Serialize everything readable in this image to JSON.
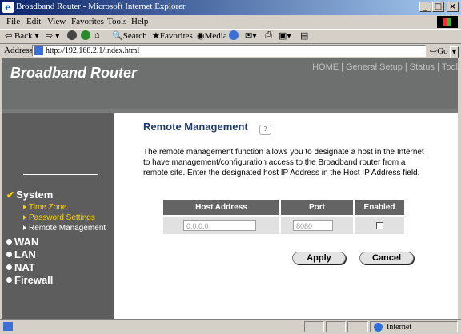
{
  "window": {
    "title": "Broadband Router - Microsoft Internet Explorer"
  },
  "menu": [
    "File",
    "Edit",
    "View",
    "Favorites",
    "Tools",
    "Help"
  ],
  "toolbar": {
    "back": "Back",
    "search": "Search",
    "favorites": "Favorites",
    "media": "Media"
  },
  "address": {
    "label": "Address",
    "url": "http://192.168.2.1/index.html",
    "go": "Go"
  },
  "header": {
    "brand": "Broadband Router",
    "nav": [
      "HOME",
      "General Setup",
      "Status",
      "Tool"
    ]
  },
  "sidebar": {
    "system": "System",
    "system_items": [
      "Time Zone",
      "Password Settings",
      "Remote Management"
    ],
    "sections": [
      "WAN",
      "LAN",
      "NAT",
      "Firewall"
    ]
  },
  "main": {
    "title": "Remote Management",
    "description": [
      "The remote management function allows you to designate a host in the Internet",
      "to have management/configuration access to the Broadband router from a",
      "remote site. Enter the designated host IP Address in the Host IP Address field."
    ],
    "table": {
      "headers": [
        "Host Address",
        "Port",
        "Enabled"
      ],
      "host_value": "0.0.0.0",
      "port_value": "8080",
      "enabled": false
    },
    "apply": "Apply",
    "cancel": "Cancel"
  },
  "status": {
    "zone": "Internet"
  },
  "colors": {
    "banner": "#6e7070",
    "sidebar": "#5d5d5d",
    "submenu": "#ffd400",
    "title": "#1f3a6c",
    "table_header": "#646464"
  }
}
